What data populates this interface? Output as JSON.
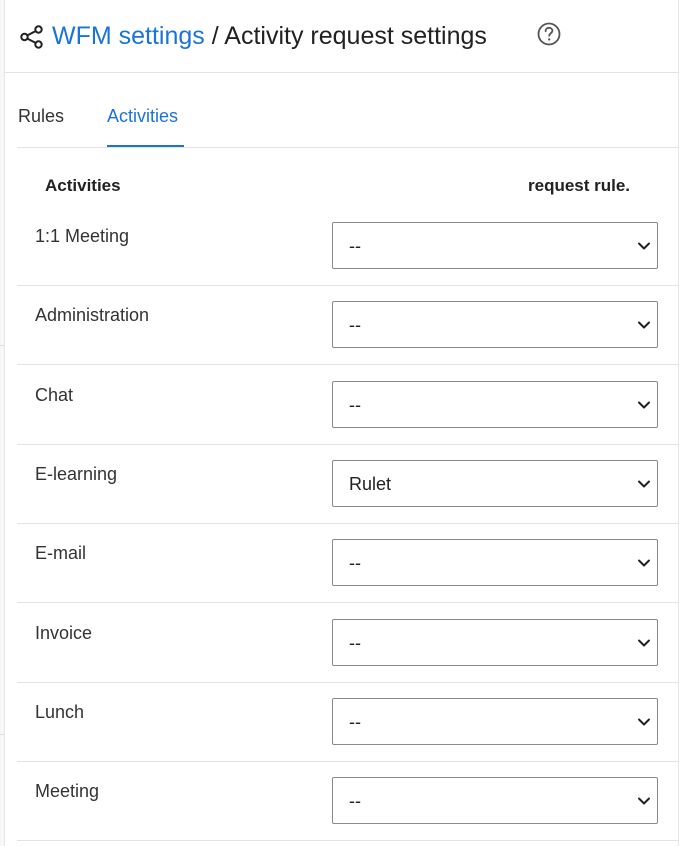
{
  "header": {
    "link_text": "WFM settings",
    "separator": "/",
    "current": "Activity request settings"
  },
  "icons": {
    "share": "share-icon",
    "help": "help-circle-icon",
    "dropdown": "chevron-down-icon"
  },
  "tabs": [
    {
      "label": "Rules",
      "active": false
    },
    {
      "label": "Activities",
      "active": true
    }
  ],
  "columns": {
    "activities": "Activities",
    "rule": "request rule."
  },
  "rows": [
    {
      "activity": "1:1 Meeting",
      "rule": "--"
    },
    {
      "activity": "Administration",
      "rule": "--"
    },
    {
      "activity": "Chat",
      "rule": "--"
    },
    {
      "activity": "E-learning",
      "rule": "Rulet"
    },
    {
      "activity": "E-mail",
      "rule": "--"
    },
    {
      "activity": "Invoice",
      "rule": "--"
    },
    {
      "activity": "Lunch",
      "rule": "--"
    },
    {
      "activity": "Meeting",
      "rule": "--"
    }
  ],
  "colors": {
    "accent": "#1a73d9",
    "divider": "#e3e3e3",
    "select_border": "#8a8a8a"
  }
}
